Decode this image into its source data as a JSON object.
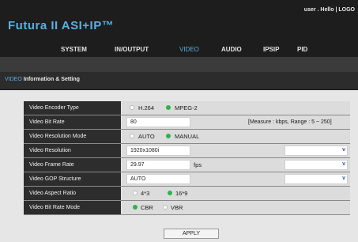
{
  "app": {
    "title": "Futura II ASI+IP™"
  },
  "user": {
    "text": "user . Hello | LOGO"
  },
  "nav": [
    "SYSTEM",
    "IN/OUTPUT",
    "VIDEO",
    "AUDIO",
    "IPSIP",
    "PID"
  ],
  "section": {
    "prefix": "VIDEO",
    "title": "Information & Setting"
  },
  "rows": {
    "encoder_type": {
      "label": "Video Encoder Type",
      "opt1": "H.264",
      "opt2": "MPEG-2"
    },
    "bit_rate": {
      "label": "Video Bit Rate",
      "value": "80",
      "note": "[Measure : kbps, Range : 5 ~ 250]"
    },
    "resolution_mode": {
      "label": "Video Resolution Mode",
      "opt1": "AUTO",
      "opt2": "MANUAL"
    },
    "resolution": {
      "label": "Video Resolution",
      "value": "1920x1080i"
    },
    "frame_rate": {
      "label": "Video Frame Rate",
      "value": "29.97",
      "unit": "fps"
    },
    "gop_structure": {
      "label": "Video GOP Structure",
      "value": "AUTO"
    },
    "aspect_ratio": {
      "label": "Video Aspect Ratio",
      "opt1": "4*3",
      "opt2": "16*9"
    },
    "bit_rate_mode": {
      "label": "Video Bit Rate Mode",
      "opt1": "CBR",
      "opt2": "VBR"
    }
  },
  "select_arrow": "v",
  "apply": {
    "label": "APPLY"
  }
}
